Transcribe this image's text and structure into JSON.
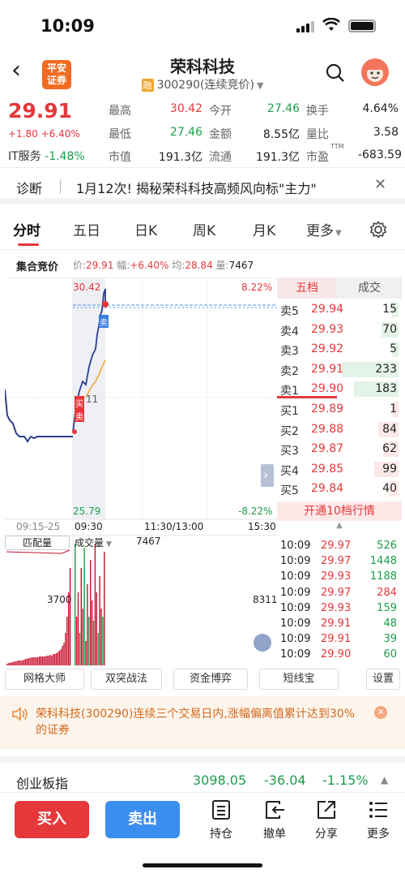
{
  "status": {
    "time": "10:09"
  },
  "header": {
    "broker_logo": "平安\n证券",
    "name": "荣科科技",
    "margin_tag": "融",
    "code": "300290(连续竞价)"
  },
  "quote": {
    "price": "29.91",
    "change": "+1.80 +6.40%",
    "sector_name": "IT服务",
    "sector_change": "-1.48%",
    "high_label": "最高",
    "high": "30.42",
    "open_label": "今开",
    "open": "27.46",
    "turnover_rate_label": "换手",
    "turnover_rate": "4.64%",
    "low_label": "最低",
    "low": "27.46",
    "amount_label": "金额",
    "amount": "8.55亿",
    "vol_ratio_label": "量比",
    "vol_ratio": "3.58",
    "mktcap_label": "市值",
    "mktcap": "191.3亿",
    "float_label": "流通",
    "float": "191.3亿",
    "pe_label": "市盈",
    "pe_sup": "TTM",
    "pe": "-683.59"
  },
  "diagnose": {
    "label": "诊断",
    "text": "1月12次! 揭秘荣科科技高频风向标\"主力\""
  },
  "tabs": [
    "分时",
    "五日",
    "日K",
    "周K",
    "月K",
    "更多"
  ],
  "inforow": {
    "title": "集合竞价",
    "price_label": "价:",
    "price": "29.91",
    "range_label": "幅:",
    "range": "+6.40%",
    "avg_label": "均:",
    "avg": "28.84",
    "vol_label": "量:",
    "vol": "7467"
  },
  "chart": {
    "top_price": "30.42",
    "top_pct": "8.22%",
    "bottom_price": "25.79",
    "bottom_pct": "-8.22%",
    "t1": "09:15-25",
    "t2": "09:30",
    "t3": "11:30/13:00",
    "t4": "15:30",
    "buy_tag": "买",
    "sell_tag": "卖",
    "buy_tag2": "买",
    "sell_tag2": "卖",
    "mid_value": "11",
    "vol_tab1": "匹配量",
    "vol_tab2": "成交量",
    "vol_total": "7467",
    "vol_left": "3700",
    "vol_right": "8311",
    "nav_arrow": "›"
  },
  "orderbook": {
    "header_left": "五档",
    "header_right": "成交",
    "asks": [
      {
        "label": "卖5",
        "price": "29.94",
        "vol": "15"
      },
      {
        "label": "卖4",
        "price": "29.93",
        "vol": "70"
      },
      {
        "label": "卖3",
        "price": "29.92",
        "vol": "5"
      },
      {
        "label": "卖2",
        "price": "29.91",
        "vol": "233"
      },
      {
        "label": "卖1",
        "price": "29.90",
        "vol": "183"
      }
    ],
    "bids": [
      {
        "label": "买1",
        "price": "29.89",
        "vol": "1"
      },
      {
        "label": "买2",
        "price": "29.88",
        "vol": "84"
      },
      {
        "label": "买3",
        "price": "29.87",
        "vol": "62"
      },
      {
        "label": "买4",
        "price": "29.85",
        "vol": "99"
      },
      {
        "label": "买5",
        "price": "29.84",
        "vol": "40"
      }
    ],
    "open10": "开通10档行情",
    "expand": "▲"
  },
  "trades": [
    {
      "t": "10:09",
      "p": "29.97",
      "v": "526",
      "c": "green"
    },
    {
      "t": "10:09",
      "p": "29.97",
      "v": "1448",
      "c": "green"
    },
    {
      "t": "10:09",
      "p": "29.93",
      "v": "1188",
      "c": "green"
    },
    {
      "t": "10:09",
      "p": "29.97",
      "v": "284",
      "c": "red"
    },
    {
      "t": "10:09",
      "p": "29.93",
      "v": "159",
      "c": "green"
    },
    {
      "t": "10:09",
      "p": "29.91",
      "v": "48",
      "c": "green"
    },
    {
      "t": "10:09",
      "p": "29.91",
      "v": "39",
      "c": "green"
    },
    {
      "t": "10:09",
      "p": "29.90",
      "v": "60",
      "c": "green"
    }
  ],
  "tools": [
    "网格大师",
    "双突战法",
    "资金博弈",
    "短线宝",
    "设置"
  ],
  "notice": {
    "text": "荣科科技(300290)连续三个交易日内,涨幅偏离值累计达到30%的证券"
  },
  "index": {
    "name": "创业板指",
    "value": "3098.05",
    "change": "-36.04",
    "pct": "-1.15%",
    "arrow": "▲"
  },
  "bottom": {
    "buy": "买入",
    "sell": "卖出",
    "hold": "持仓",
    "cancel": "撤单",
    "share": "分享",
    "more": "更多"
  },
  "colors": {
    "up": "#e5383b",
    "down": "#1a9e4b",
    "price_line": "#2b3f8c",
    "avg_line": "#f0a62e",
    "sell_btn": "#3b8ef0"
  }
}
